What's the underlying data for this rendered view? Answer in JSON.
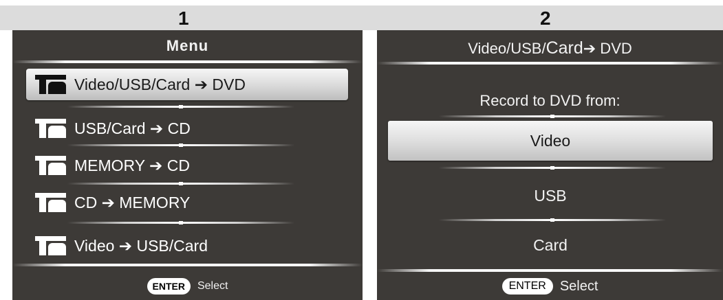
{
  "steps": {
    "step1": "1",
    "step2": "2"
  },
  "menu_panel": {
    "title": "Menu",
    "items": [
      {
        "label": "Video/USB/Card ➔ DVD",
        "selected": true
      },
      {
        "label": "USB/Card ➔ CD",
        "selected": false
      },
      {
        "label": "MEMORY ➔ CD",
        "selected": false
      },
      {
        "label": "CD ➔ MEMORY",
        "selected": false
      },
      {
        "label": "Video ➔ USB/Card",
        "selected": false
      }
    ],
    "footer": {
      "key": "ENTER",
      "action": "Select"
    }
  },
  "record_panel": {
    "title_prefix": "Video/USB/",
    "title_card": "Card",
    "title_suffix": "➔ DVD",
    "subtitle": "Record to DVD from:",
    "options": [
      {
        "label": "Video",
        "selected": true
      },
      {
        "label": "USB",
        "selected": false
      },
      {
        "label": "Card",
        "selected": false
      }
    ],
    "footer": {
      "key": "ENTER",
      "action": "Select"
    }
  },
  "icons": {
    "menu_item_icon": "disc-copy-icon"
  },
  "colors": {
    "panel_bg": "#3d3a37",
    "strip_bg": "#dcdcdc",
    "highlight_light": "#f6f6f6",
    "highlight_dark": "#bdbdbd",
    "text": "#ffffff"
  }
}
